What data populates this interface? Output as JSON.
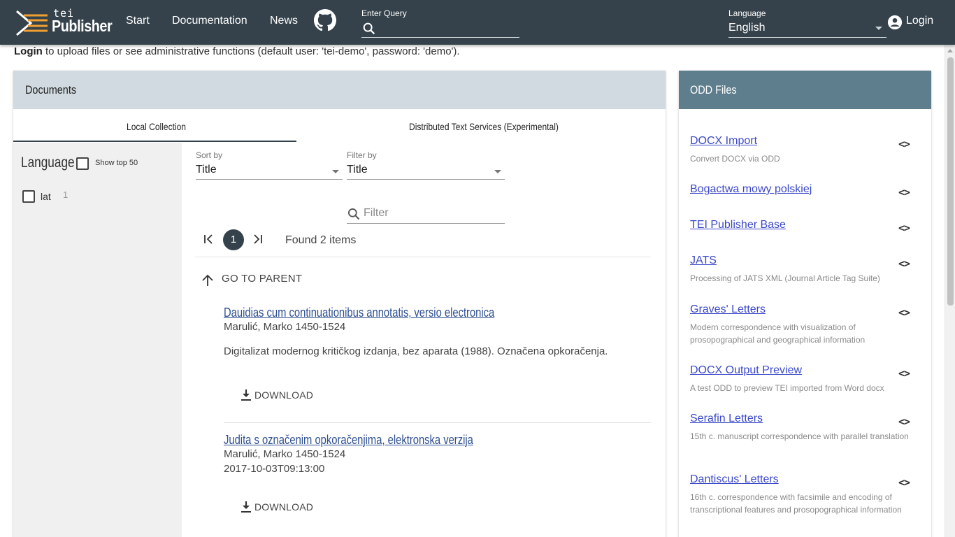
{
  "header": {
    "logo_tei": "tei",
    "logo_publisher": "Publisher",
    "nav": [
      "Start",
      "Documentation",
      "News"
    ],
    "query_label": "Enter Query",
    "language_label": "Language",
    "language_value": "English",
    "login_label": "Login"
  },
  "intro": {
    "login_word": "Login",
    "text": " to upload files or see administrative functions (default user: 'tei-demo', password: 'demo')."
  },
  "documents": {
    "title": "Documents",
    "tabs": [
      "Local Collection",
      "Distributed Text Services (Experimental)"
    ],
    "facet": {
      "title": "Language",
      "show_top": "Show top 50",
      "values": [
        {
          "label": "lat",
          "count": "1"
        }
      ]
    },
    "sort_label": "Sort by",
    "sort_value": "Title",
    "filterby_label": "Filter by",
    "filterby_value": "Title",
    "filter_placeholder": "Filter",
    "current_page": "1",
    "found": "Found 2 items",
    "go_parent": "GO TO PARENT",
    "items": [
      {
        "title": "Dauidias cum continuationibus annotatis, versio electronica",
        "author": "Marulić, Marko 1450-1524",
        "description": "Digitalizat modernog kritičkog izdanja, bez aparata (1988). Označena opkoračenja.",
        "download": "DOWNLOAD"
      },
      {
        "title": "Judita s označenim opkoračenjima, elektronska verzija",
        "author": "Marulić, Marko 1450-1524",
        "date": "2017-10-03T09:13:00",
        "download": "DOWNLOAD"
      }
    ]
  },
  "odd": {
    "title": "ODD Files",
    "code_symbol": "<>",
    "items": [
      {
        "name": "DOCX Import",
        "desc": "Convert DOCX via ODD"
      },
      {
        "name": "Bogactwa mowy polskiej",
        "desc": ""
      },
      {
        "name": "TEI Publisher Base",
        "desc": ""
      },
      {
        "name": "JATS",
        "desc": "Processing of JATS XML (Journal Article Tag Suite)"
      },
      {
        "name": "Graves' Letters",
        "desc": "Modern correspondence with visualization of prosopographical and geographical information"
      },
      {
        "name": "DOCX Output Preview",
        "desc": "A test ODD to preview TEI imported from Word docx"
      },
      {
        "name": "Serafin Letters",
        "desc": "15th c. manuscript correspondence with parallel translation"
      },
      {
        "name": "Dantiscus' Letters",
        "desc": "16th c. correspondence with facsimile and encoding of transcriptional features and prosopographical information"
      }
    ]
  },
  "colors": {
    "topbar": "#35424b",
    "doc_header": "#d1dae0",
    "odd_header": "#5e7d8d",
    "link": "#3b48c8",
    "doc_title": "#2d4e8f"
  }
}
